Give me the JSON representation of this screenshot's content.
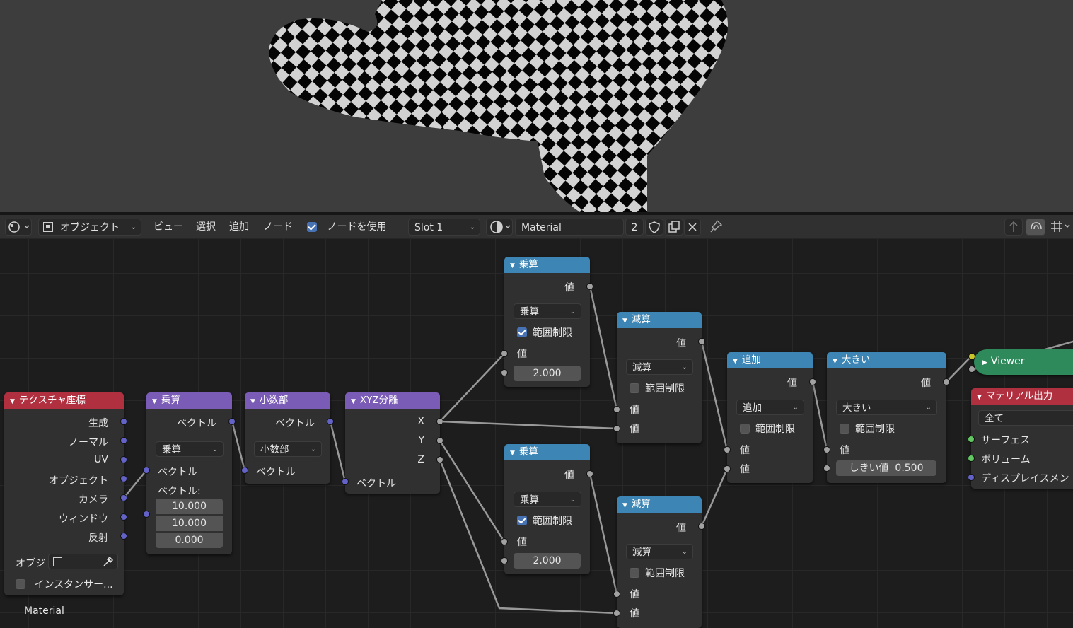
{
  "header": {
    "editor_type_icon": "node-editor-icon",
    "object_mode": "オブジェクト",
    "menus": [
      "ビュー",
      "選択",
      "追加",
      "ノード"
    ],
    "use_nodes_label": "ノードを使用",
    "use_nodes_checked": true,
    "slot": "Slot 1",
    "material_name": "Material",
    "user_count": "2"
  },
  "nodes": {
    "texcoord": {
      "title": "テクスチャ座標",
      "outputs": [
        "生成",
        "ノーマル",
        "UV",
        "オブジェクト",
        "カメラ",
        "ウィンドウ",
        "反射"
      ],
      "object_label": "オブジ",
      "instancer_label": "インスタンサー..."
    },
    "vecmul": {
      "title": "乗算",
      "output": "ベクトル",
      "op": "乗算",
      "input1": "ベクトル",
      "input2": "ベクトル:",
      "values": [
        "10.000",
        "10.000",
        "0.000"
      ]
    },
    "fraction": {
      "title": "小数部",
      "output": "ベクトル",
      "op": "小数部",
      "input": "ベクトル"
    },
    "sepxyz": {
      "title": "XYZ分離",
      "outputs": [
        "X",
        "Y",
        "Z"
      ],
      "input": "ベクトル"
    },
    "mul1": {
      "title": "乗算",
      "output": "値",
      "op": "乗算",
      "clamp": "範囲制限",
      "clamp_on": true,
      "input1": "値",
      "value": "2.000"
    },
    "mul2": {
      "title": "乗算",
      "output": "値",
      "op": "乗算",
      "clamp": "範囲制限",
      "clamp_on": true,
      "input1": "値",
      "value": "2.000"
    },
    "sub1": {
      "title": "減算",
      "output": "値",
      "op": "減算",
      "clamp": "範囲制限",
      "inputs": [
        "値",
        "値"
      ]
    },
    "sub2": {
      "title": "減算",
      "output": "値",
      "op": "減算",
      "clamp": "範囲制限",
      "inputs": [
        "値",
        "値"
      ]
    },
    "add": {
      "title": "追加",
      "output": "値",
      "op": "追加",
      "clamp": "範囲制限",
      "inputs": [
        "値",
        "値"
      ]
    },
    "greater": {
      "title": "大きい",
      "output": "値",
      "op": "大きい",
      "clamp": "範囲制限",
      "input": "値",
      "threshold_label": "しきい値",
      "threshold": "0.500"
    },
    "viewer": {
      "title": "Viewer"
    },
    "matout": {
      "title": "マテリアル出力",
      "target": "全て",
      "inputs": [
        "サーフェス",
        "ボリューム",
        "ディスプレイスメン"
      ]
    }
  },
  "frame_label": "Material",
  "colors": {
    "math_header": "#3c85b4",
    "vector_header": "#7a5bb5",
    "input_header": "#b03040",
    "viewer": "#2f8a5b"
  }
}
